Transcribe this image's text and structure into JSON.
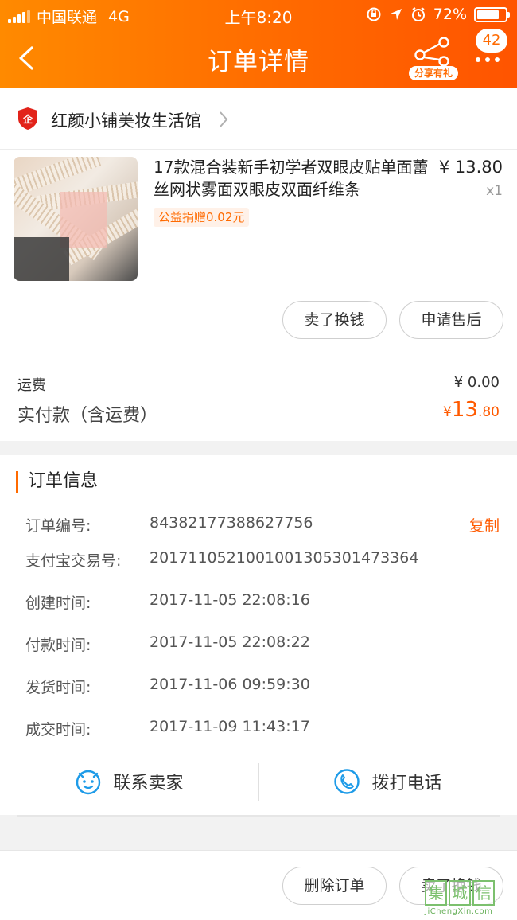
{
  "status_bar": {
    "carrier": "中国联通",
    "network": "4G",
    "time": "上午8:20",
    "battery": "72%"
  },
  "header": {
    "title": "订单详情",
    "share_label": "分享有礼",
    "badge_count": "42"
  },
  "shop": {
    "name": "红颜小铺美妆生活馆"
  },
  "product": {
    "title": "17款混合装新手初学者双眼皮贴单面蕾丝网状雾面双眼皮双面纤维条",
    "price": "¥ 13.80",
    "quantity": "x1",
    "charity_tag": "公益捐赠0.02元"
  },
  "item_actions": {
    "sell_label": "卖了换钱",
    "after_sale_label": "申请售后"
  },
  "totals": {
    "shipping_label": "运费",
    "shipping_value": "¥ 0.00",
    "paid_label": "实付款（含运费）",
    "paid_currency": "¥",
    "paid_integer": "13",
    "paid_decimal": ".80"
  },
  "order_info": {
    "section_title": "订单信息",
    "copy_label": "复制",
    "rows": [
      {
        "label": "订单编号:",
        "value": "84382177388627756"
      },
      {
        "label": "支付宝交易号:",
        "value": "2017110521001001305301473364"
      },
      {
        "label": "创建时间:",
        "value": "2017-11-05 22:08:16"
      },
      {
        "label": "付款时间:",
        "value": "2017-11-05 22:08:22"
      },
      {
        "label": "发货时间:",
        "value": "2017-11-06 09:59:30"
      },
      {
        "label": "成交时间:",
        "value": "2017-11-09 11:43:17"
      }
    ]
  },
  "contact": {
    "seller_label": "联系卖家",
    "call_label": "拨打电话"
  },
  "bottom_actions": {
    "delete_label": "删除订单",
    "sell_label": "卖了换钱"
  },
  "watermark": {
    "chars": [
      "集",
      "城",
      "信"
    ],
    "url": "JiChengXin.com"
  },
  "colors": {
    "accent": "#ff6a00",
    "price_highlight": "#ff5a00"
  }
}
